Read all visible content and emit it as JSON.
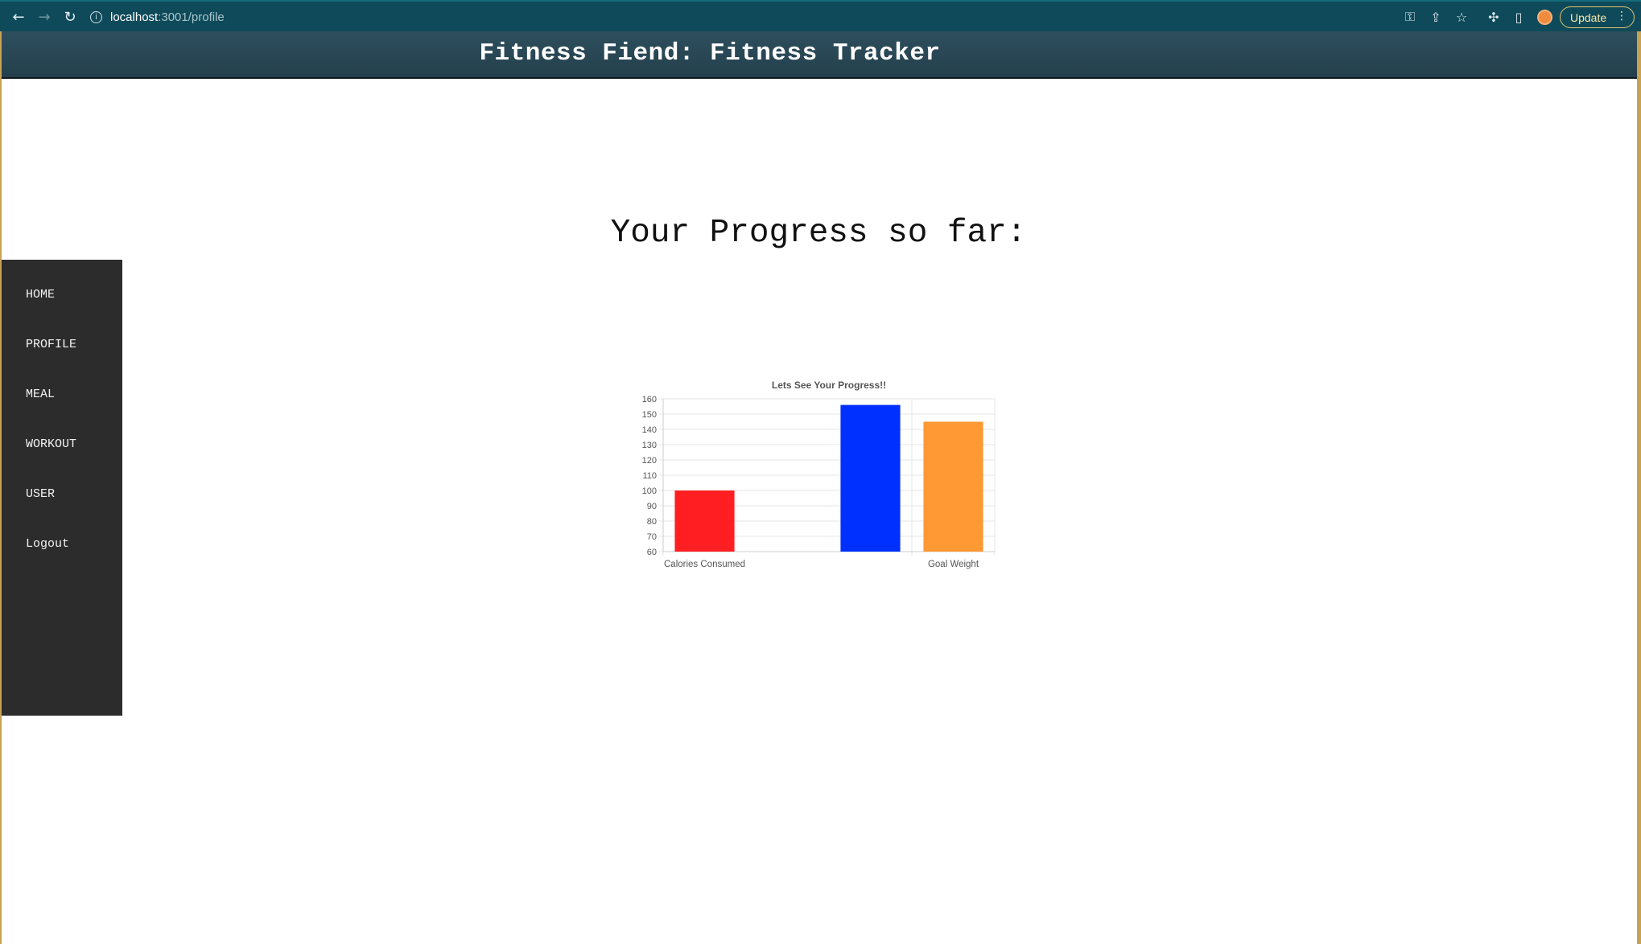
{
  "browser": {
    "url_host": "localhost",
    "url_path": ":3001/profile",
    "update_label": "Update"
  },
  "header": {
    "title": "Fitness Fiend: Fitness Tracker"
  },
  "main": {
    "heading": "Your Progress so far:"
  },
  "sidebar": {
    "items": [
      {
        "label": "HOME"
      },
      {
        "label": "PROFILE"
      },
      {
        "label": "MEAL"
      },
      {
        "label": "WORKOUT"
      },
      {
        "label": "USER"
      },
      {
        "label": "Logout"
      }
    ]
  },
  "chart_data": {
    "type": "bar",
    "title": "Lets See Your Progress!!",
    "categories": [
      "Calories Consumed",
      "",
      "Goal Weight"
    ],
    "category_slots": 4,
    "series": [
      {
        "category_index": 0,
        "value": 100,
        "color": "#ff1f22"
      },
      {
        "category_index": 2,
        "value": 156,
        "color": "#0030ff"
      },
      {
        "category_index": 3,
        "value": 145,
        "color": "#ff9933"
      }
    ],
    "y_ticks": [
      60,
      70,
      80,
      90,
      100,
      110,
      120,
      130,
      140,
      150,
      160
    ],
    "ylim": [
      60,
      160
    ],
    "grid": true
  }
}
